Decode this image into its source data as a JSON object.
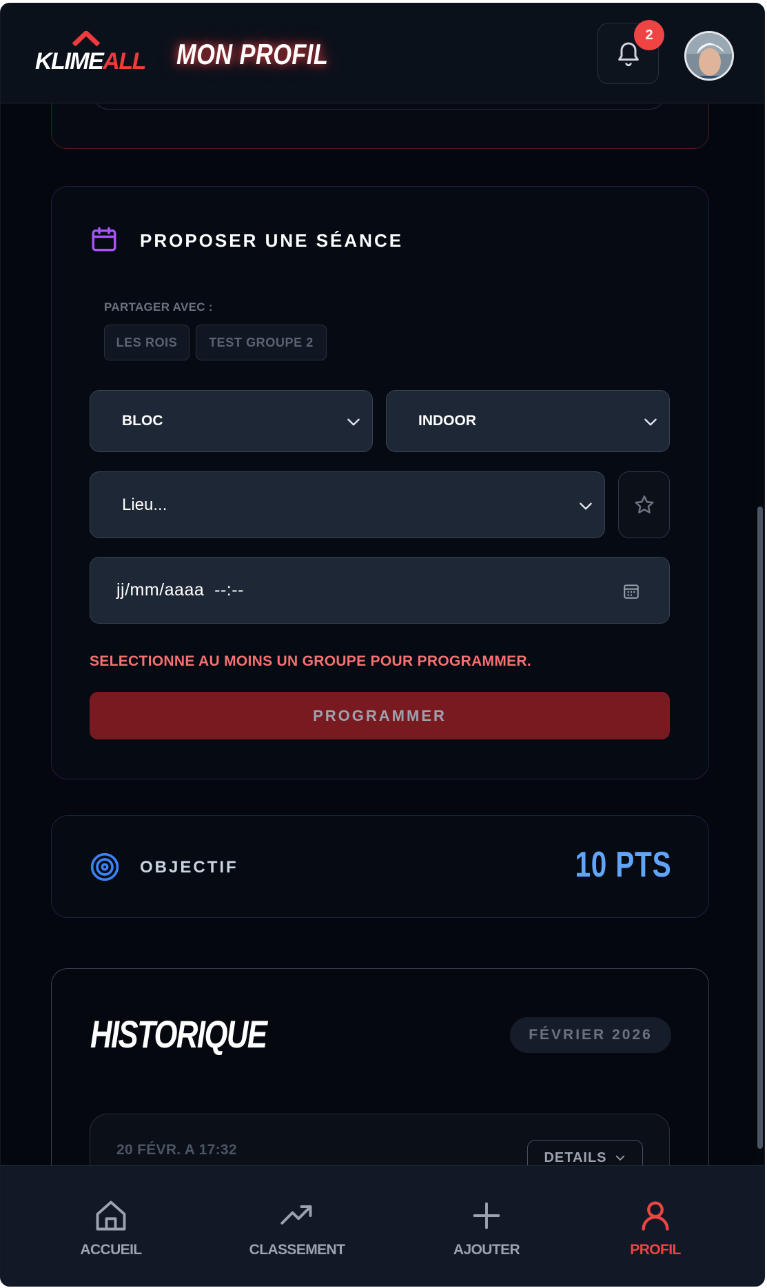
{
  "header": {
    "logo_first": "KLIME",
    "logo_second": "ALL",
    "title": "MON PROFIL",
    "notification_count": "2"
  },
  "propose": {
    "title": "PROPOSER UNE SÉANCE",
    "share_label": "PARTAGER AVEC :",
    "groups": [
      "LES ROIS",
      "TEST GROUPE 2"
    ],
    "type_value": "BLOC",
    "environment_value": "INDOOR",
    "location_placeholder": "Lieu...",
    "date_placeholder": "jj/mm/aaaa  --:--",
    "warning": "SELECTIONNE AU MOINS UN GROUPE POUR PROGRAMMER.",
    "submit_label": "PROGRAMMER"
  },
  "objectif": {
    "title": "OBJECTIF",
    "value": "10 PTS"
  },
  "historique": {
    "title": "HISTORIQUE",
    "month": "FÉVRIER 2026",
    "items": [
      {
        "date": "20 FÉVR. A 17:32",
        "details_label": "DETAILS"
      }
    ]
  },
  "nav": {
    "items": [
      {
        "label": "ACCUEIL",
        "icon": "home-icon"
      },
      {
        "label": "CLASSEMENT",
        "icon": "trending-up-icon"
      },
      {
        "label": "AJOUTER",
        "icon": "plus-icon"
      },
      {
        "label": "PROFIL",
        "icon": "user-icon"
      }
    ],
    "active": "PROFIL"
  },
  "colors": {
    "accent_red": "#ef4444",
    "accent_blue": "#60a5fa",
    "accent_purple": "#a855f7",
    "background": "#04070e"
  }
}
